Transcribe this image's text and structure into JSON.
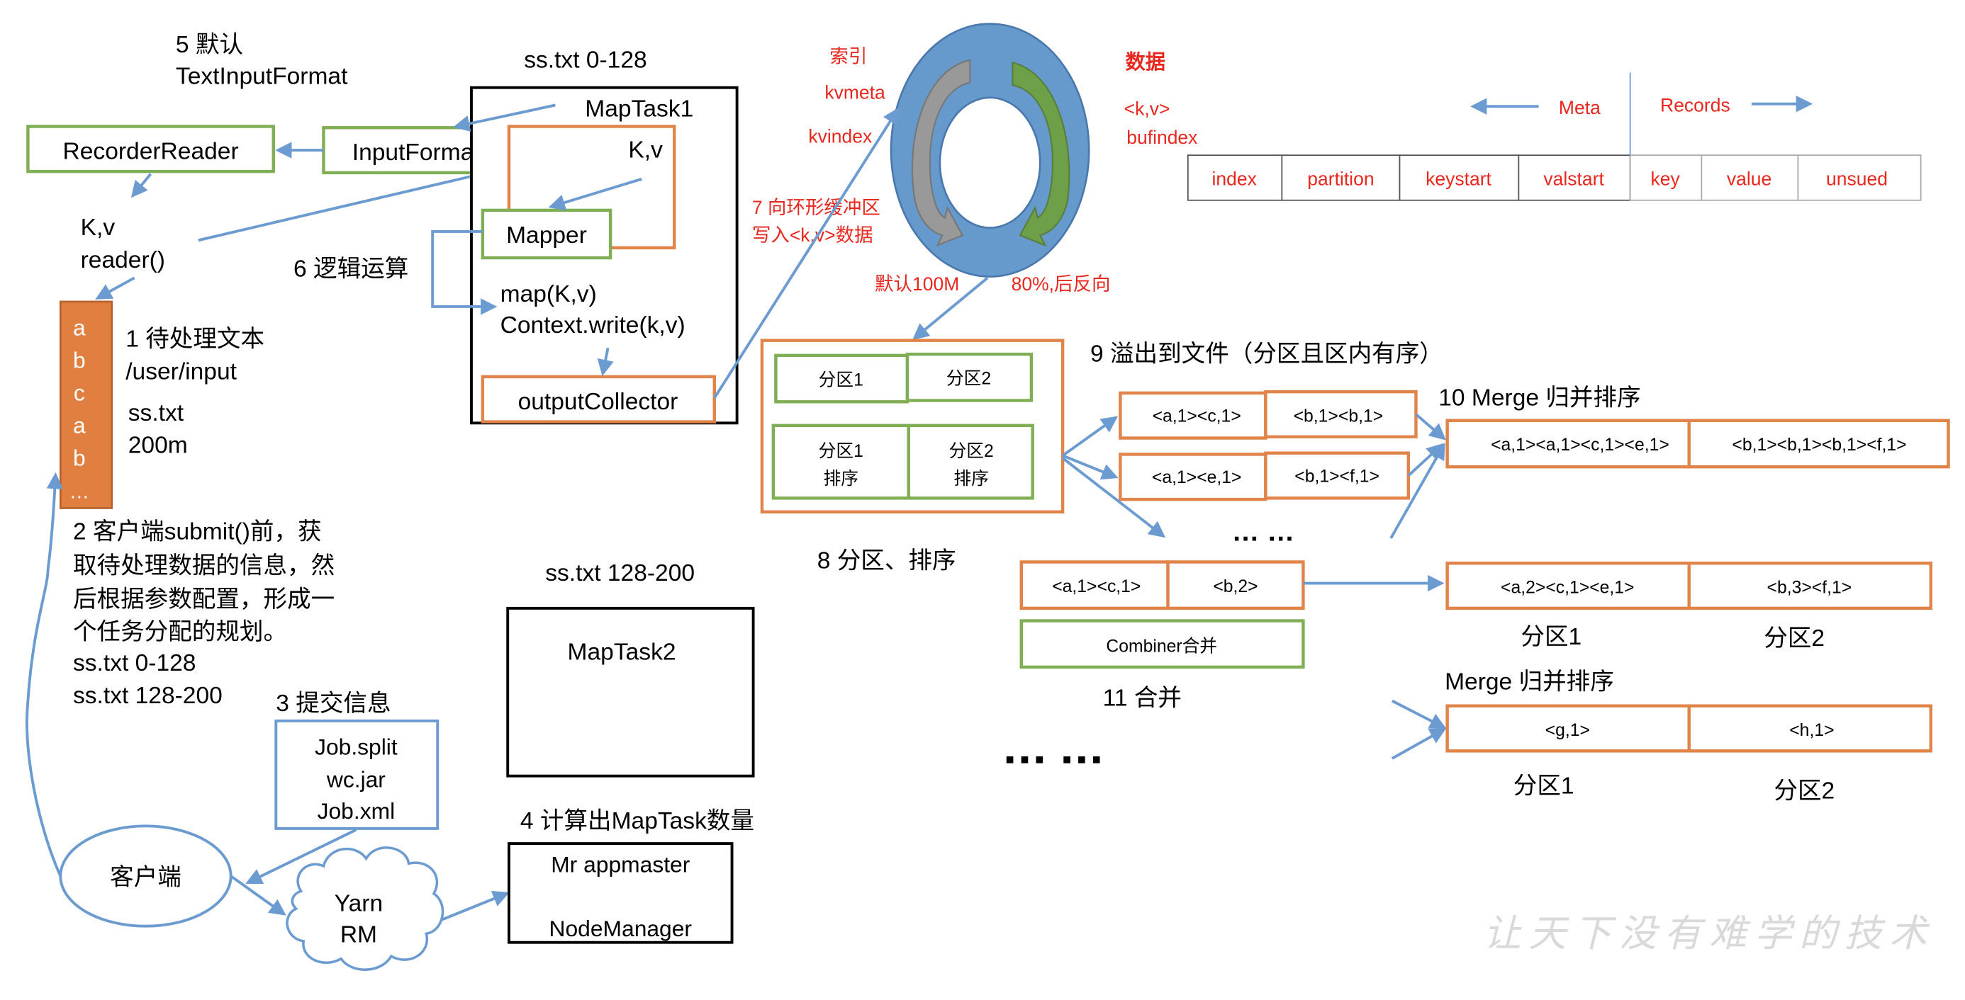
{
  "steps": {
    "s1": {
      "title": "1 待处理文本",
      "path": "/user/input",
      "file": "ss.txt",
      "size": "200m"
    },
    "s2": {
      "lines": [
        "2 客户端submit()前，获",
        "取待处理数据的信息，然",
        "后根据参数配置，形成一",
        "个任务分配的规划。"
      ],
      "split1": "ss.txt  0-128",
      "split2": "ss.txt  128-200"
    },
    "s3": {
      "title": "3 提交信息",
      "files": [
        "Job.split",
        "wc.jar",
        "Job.xml"
      ]
    },
    "s4": {
      "title": "4 计算出MapTask数量",
      "box_line1": "Mr appmaster",
      "box_line2": "NodeManager"
    },
    "s5": {
      "line1": "5 默认",
      "line2": "TextInputFormat"
    },
    "s6": {
      "title": "6 逻辑运算"
    },
    "s7": {
      "line1": "7 向环形缓冲区",
      "line2": "写入<k,v>数据"
    },
    "s8": {
      "title": "8 分区、排序"
    },
    "s9": {
      "title": "9 溢出到文件（分区且区内有序）"
    },
    "s10": {
      "title": "10 Merge 归并排序"
    },
    "s11": {
      "title": "11 合并"
    }
  },
  "file_block": {
    "chars": [
      "a",
      "b",
      "c",
      "a",
      "b",
      "…"
    ]
  },
  "left": {
    "recorder_reader": "RecorderReader",
    "input_format": "InputFormat",
    "kv": "K,v",
    "reader": "reader()"
  },
  "client": {
    "label": "客户端",
    "yarn_line1": "Yarn",
    "yarn_line2": "RM"
  },
  "maptask1": {
    "split_label": "ss.txt 0-128",
    "title": "MapTask1",
    "kv": "K,v",
    "mapper": "Mapper",
    "map_call": "map(K,v)",
    "context_write": "Context.write(k,v)",
    "output_collector": "outputCollector"
  },
  "maptask2": {
    "split_label": "ss.txt 128-200",
    "title": "MapTask2"
  },
  "ring_buffer": {
    "index_label": "索引",
    "kvmeta": "kvmeta",
    "kvindex": "kvindex",
    "data_label": "数据",
    "kv": "<k,v>",
    "bufindex": "bufindex",
    "default_size": "默认100M",
    "threshold": "80%,后反向"
  },
  "meta_table": {
    "meta_label": "Meta",
    "records_label": "Records",
    "meta_cells": [
      "index",
      "partition",
      "keystart",
      "valstart"
    ],
    "record_cells": [
      "key",
      "value",
      "unsued"
    ]
  },
  "partition_box": {
    "p1": "分区1",
    "p2": "分区2",
    "p1_sorted_1": "分区1",
    "p1_sorted_2": "排序",
    "p2_sorted_1": "分区2",
    "p2_sorted_2": "排序"
  },
  "spill_files": [
    {
      "p1": "<a,1><c,1>",
      "p2": "<b,1><b,1>"
    },
    {
      "p1": "<a,1><e,1>",
      "p2": "<b,1><f,1>"
    }
  ],
  "spill_ellipsis": "… …",
  "merged": {
    "p1": "<a,1><a,1><c,1><e,1>",
    "p2": "<b,1><b,1><b,1><f,1>"
  },
  "combiner": {
    "p1": "<a,1><c,1>",
    "p2": "<b,2>",
    "label": "Combiner合并"
  },
  "combined_result": {
    "p1": "<a,2><c,1><e,1>",
    "p2": "<b,3><f,1>",
    "label_p1": "分区1",
    "label_p2": "分区2"
  },
  "merge2": {
    "title": "Merge 归并排序",
    "p1": "<g,1>",
    "p2": "<h,1>",
    "label_p1": "分区1",
    "label_p2": "分区2"
  },
  "bottom_ellipsis": "▪▪▪  ▪▪▪",
  "watermark": "让天下没有难学的技术",
  "colors": {
    "green": "#7fae54",
    "orange": "#e0844a",
    "blue": "#6b9bd1",
    "red": "#e8271f",
    "ring": "#6699cc"
  }
}
